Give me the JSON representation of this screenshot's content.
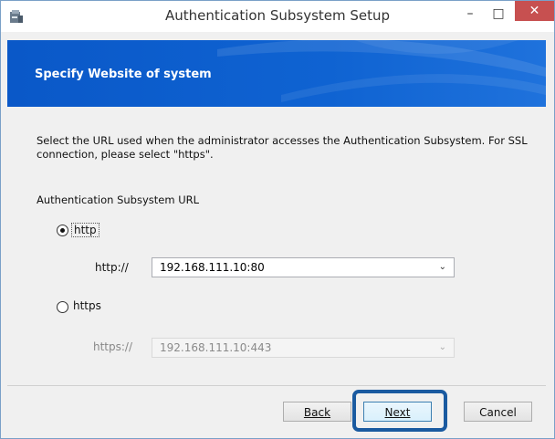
{
  "window": {
    "title": "Authentication Subsystem Setup",
    "minimize_symbol": "–",
    "maximize_symbol": "□",
    "close_symbol": "✕",
    "icon": "installer-icon"
  },
  "banner": {
    "title": "Specify Website of system"
  },
  "body": {
    "description": "Select the URL used when the administrator accesses the Authentication Subsystem. For SSL connection, please select \"https\".",
    "group_label": "Authentication Subsystem URL",
    "http_option": {
      "label": "http",
      "checked": true
    },
    "http_field": {
      "label": "http://",
      "value": "192.168.111.10:80"
    },
    "https_option": {
      "label": "https",
      "checked": false
    },
    "https_field": {
      "label": "https://",
      "value": "192.168.111.10:443"
    }
  },
  "footer": {
    "back_label": "Back",
    "next_label": "Next",
    "cancel_label": "Cancel"
  },
  "colors": {
    "banner": "#0a58c8",
    "highlight": "#1a5aa0",
    "close": "#c75050"
  }
}
